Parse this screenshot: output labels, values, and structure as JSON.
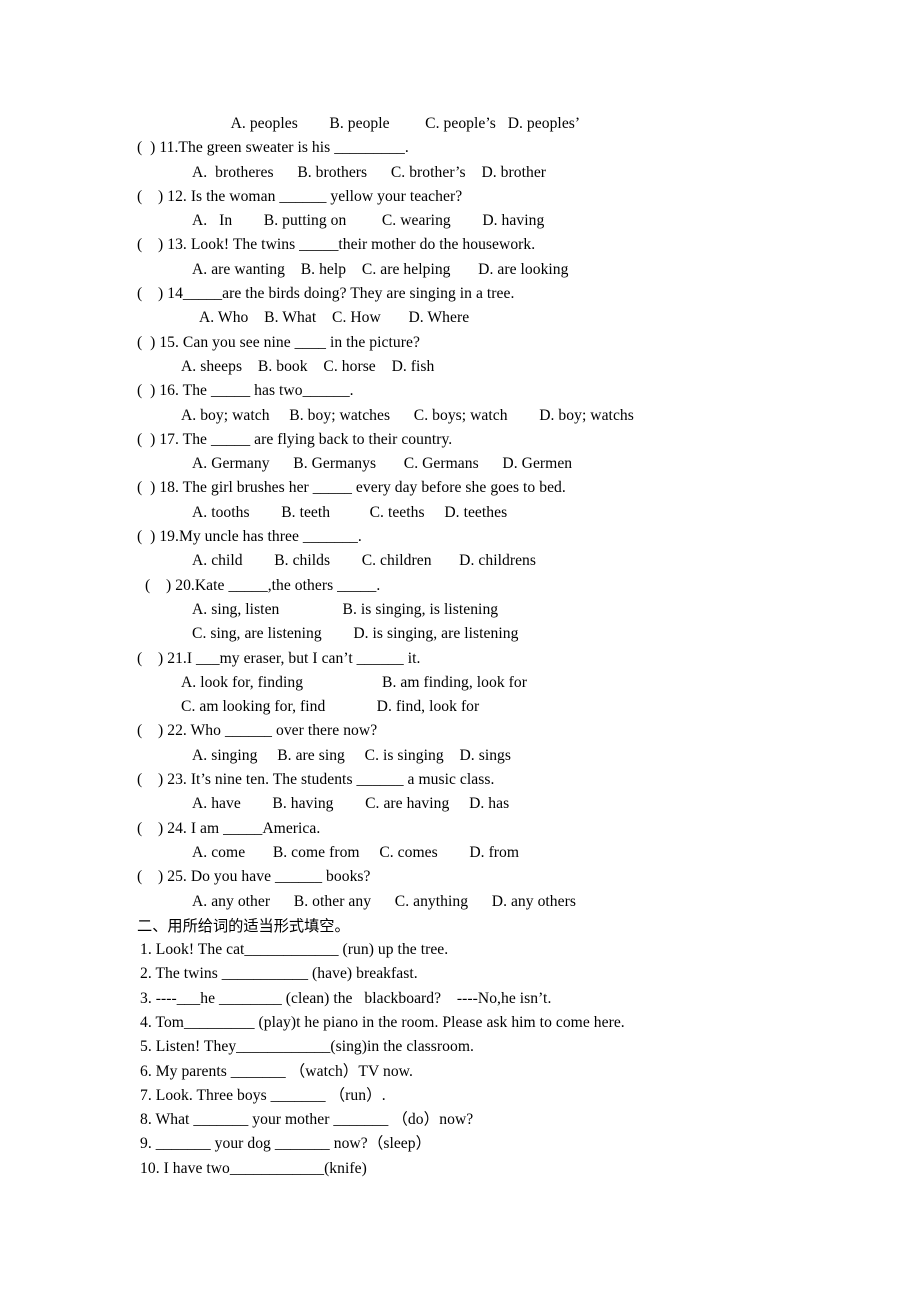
{
  "page": {
    "background_color": "#ffffff",
    "text_color": "#000000"
  },
  "section_one": {
    "continued_options_q10": "          A. peoples        B. people         C. people’s   D. peoples’",
    "questions": [
      {
        "stem": "(  ) 11.The green sweater is his _________.",
        "options": [
          "A.  brotheres      B. brothers      C. brother’s    D. brother"
        ]
      },
      {
        "stem": "(    ) 12. Is the woman ______ yellow your teacher?",
        "options": [
          "A.   In        B. putting on         C. wearing        D. having"
        ]
      },
      {
        "stem": "(    ) 13. Look! The twins _____their mother do the housework.",
        "options": [
          "A. are wanting    B. help    C. are helping       D. are looking"
        ]
      },
      {
        "stem": "(    ) 14_____are the birds doing? They are singing in a tree.",
        "options": [
          "A. Who    B. What    C. How       D. Where"
        ]
      },
      {
        "stem": "(  ) 15. Can you see nine ____ in the picture?",
        "options": [
          "A. sheeps    B. book    C. horse    D. fish"
        ]
      },
      {
        "stem": "(  ) 16. The _____ has two______.",
        "options": [
          "A. boy; watch     B. boy; watches      C. boys; watch        D. boy; watchs"
        ]
      },
      {
        "stem": "(  ) 17. The _____ are flying back to their country.",
        "options": [
          "A. Germany      B. Germanys       C. Germans      D. Germen"
        ]
      },
      {
        "stem": "(  ) 18. The girl brushes her _____ every day before she goes to bed.",
        "options": [
          "A. tooths        B. teeth          C. teeths     D. teethes"
        ]
      },
      {
        "stem": "(  ) 19.My uncle has three _______.",
        "options": [
          "A. child        B. childs        C. children       D. childrens"
        ]
      },
      {
        "stem": "(    ) 20.Kate _____,the others _____.",
        "options": [
          "A. sing, listen                B. is singing, is listening",
          "C. sing, are listening        D. is singing, are listening"
        ]
      },
      {
        "stem": "(    ) 21.I ___my eraser, but I can’t ______ it.",
        "options": [
          "A. look for, finding                    B. am finding, look for",
          "C. am looking for, find             D. find, look for"
        ]
      },
      {
        "stem": "(    ) 22. Who ______ over there now?",
        "options": [
          "A. singing     B. are sing     C. is singing    D. sings"
        ]
      },
      {
        "stem": "(    ) 23. It’s nine ten. The students ______ a music class.",
        "options": [
          "A. have        B. having        C. are having     D. has"
        ]
      },
      {
        "stem": "(    ) 24. I am _____America.",
        "options": [
          "A. come       B. come from     C. comes        D. from"
        ]
      },
      {
        "stem": "(    ) 25. Do you have ______ books?",
        "options": [
          "A. any other      B. other any      C. anything      D. any others"
        ]
      }
    ]
  },
  "section_two": {
    "heading": "二、用所给词的适当形式填空。",
    "items": [
      "1. Look! The cat____________ (run) up the tree.",
      "2. The twins ___________ (have) breakfast.",
      "3. ----___he ________ (clean) the   blackboard?    ----No,he isn’t.",
      "4. Tom_________ (play)t he piano in the room. Please ask him to come here.",
      "5. Listen! They____________(sing)in the classroom.",
      "6. My parents _______ （watch）TV now.",
      "7. Look. Three boys _______ （run）.",
      "8. What _______ your mother _______ （do）now?",
      "9. _______ your dog _______ now?（sleep）",
      "10. I have two____________(knife)"
    ]
  }
}
